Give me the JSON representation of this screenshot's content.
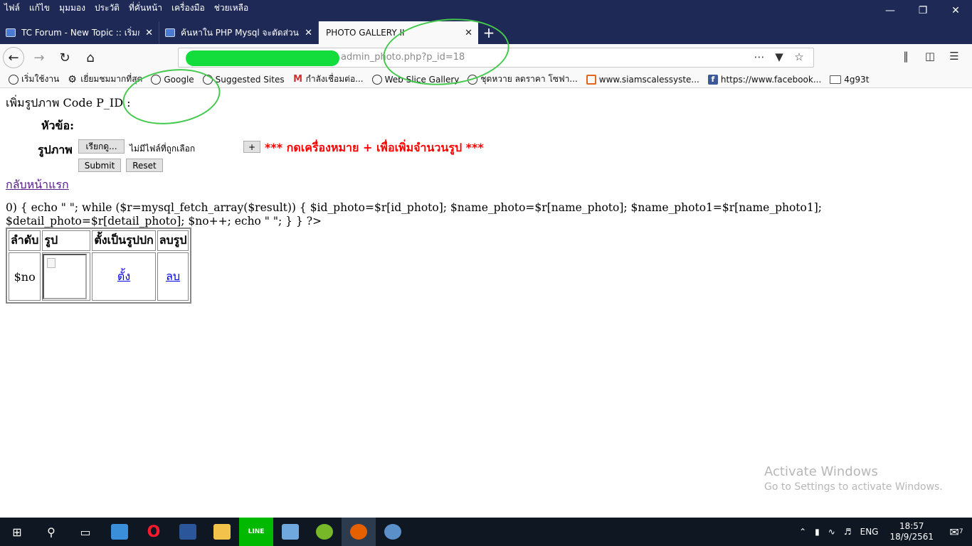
{
  "menu": [
    "ไฟล์",
    "แก้ไข",
    "มุมมอง",
    "ประวัติ",
    "ที่คั่นหน้า",
    "เครื่องมือ",
    "ช่วยเหลือ"
  ],
  "window_controls": [
    "—",
    "❐",
    "✕"
  ],
  "tabs": [
    {
      "label": "TC Forum - New Topic :: เริ่มกระ",
      "icon": "page-icon"
    },
    {
      "label": "ค้นหาใน PHP Mysql จะตัดส่วนที่เ",
      "icon": "page-icon"
    },
    {
      "label": "PHOTO GALLERY II",
      "active": true
    }
  ],
  "tab_close": "✕",
  "new_tab": "+",
  "address_bar": {
    "visible_url": "admin_photo.php?p_id=18"
  },
  "bookmarks": [
    {
      "label": "เริ่มใช้งาน",
      "icon": "globe-icon"
    },
    {
      "label": "เยี่ยมชมมากที่สุด",
      "icon": "gear-icon"
    },
    {
      "label": "Google",
      "icon": "globe-icon"
    },
    {
      "label": "Suggested Sites",
      "icon": "globe-icon"
    },
    {
      "label": "กำลังเชื่อมต่อ...",
      "icon": "gmail-icon"
    },
    {
      "label": "Web Slice Gallery",
      "icon": "globe-icon"
    },
    {
      "label": "ชุดหวาย ลดราคา โซฟา...",
      "icon": "globe-icon"
    },
    {
      "label": "www.siamscalessyste...",
      "icon": "orange-site-icon"
    },
    {
      "label": "https://www.facebook...",
      "icon": "facebook-icon"
    },
    {
      "label": "4g93t",
      "icon": "folder-icon"
    }
  ],
  "page": {
    "heading": "เพิ่มรูปภาพ Code P_ID :",
    "title_label": "หัวข้อ:",
    "image_label": "รูปภาพ",
    "browse_label": "เรียกดู...",
    "no_file_text": "ไม่มีไฟล์ที่ถูกเลือก",
    "plus_label": "+",
    "hint_text": "*** กดเครื่องหมาย + เพื่อเพิ่มจำนวนรูป ***",
    "submit_label": "Submit",
    "reset_label": "Reset",
    "home_link": "กลับหน้าแรก",
    "raw_code": "0) { echo \" \"; while ($r=mysql_fetch_array($result)) { $id_photo=$r[id_photo]; $name_photo=$r[name_photo]; $name_photo1=$r[name_photo1]; $detail_photo=$r[detail_photo]; $no++; echo \" \"; } } ?>",
    "table": {
      "headers": [
        "ลำดับ",
        "รูป",
        "ตั้งเป็นรูปปก",
        "ลบรูป"
      ],
      "row": {
        "no": "$no",
        "set_cover_link": "ตั้ง",
        "delete_link": "ลบ"
      }
    }
  },
  "watermark": {
    "line1": "Activate Windows",
    "line2": "Go to Settings to activate Windows."
  },
  "taskbar": {
    "language": "ENG",
    "time": "18:57",
    "date": "18/9/2561",
    "notification_count": "7"
  },
  "colors": {
    "hint_red": "#ff0000",
    "annotation_green": "#44c94d",
    "redaction_green": "#13dc3d",
    "titlebar": "#1e2a55"
  }
}
